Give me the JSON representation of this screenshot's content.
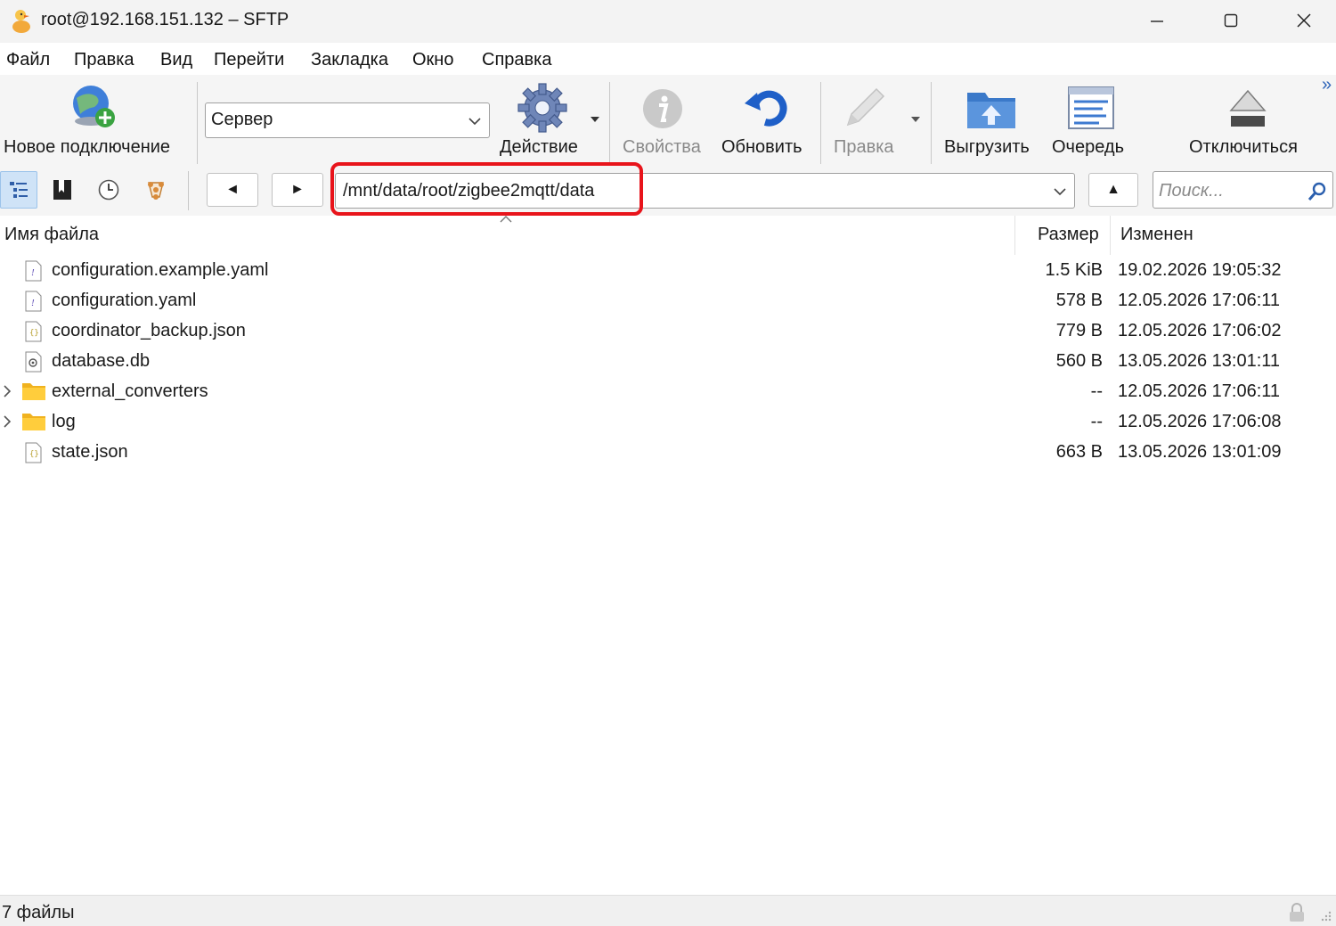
{
  "window": {
    "title": "root@192.168.151.132 – SFTP",
    "controls": [
      "minimize",
      "maximize",
      "close"
    ]
  },
  "menu": {
    "items": [
      "Файл",
      "Правка",
      "Вид",
      "Перейти",
      "Закладка",
      "Окно",
      "Справка"
    ]
  },
  "toolbar": {
    "new_connection": "Новое подключение",
    "server_combo": "Сервер",
    "action": "Действие",
    "properties": "Свойства",
    "refresh": "Обновить",
    "edit": "Правка",
    "upload": "Выгрузить",
    "queue": "Очередь",
    "disconnect": "Отключиться",
    "overflow": "»"
  },
  "pathbar": {
    "back_glyph": "◄",
    "forward_glyph": "►",
    "up_glyph": "▲",
    "path": "/mnt/data/root/zigbee2mqtt/data",
    "search_placeholder": "Поиск..."
  },
  "columns": {
    "name": "Имя файла",
    "size": "Размер",
    "modified": "Изменен"
  },
  "files": [
    {
      "name": "configuration.example.yaml",
      "size": "1.5 KiB",
      "modified": "19.02.2026 19:05:32",
      "type": "yaml-file-icon"
    },
    {
      "name": "configuration.yaml",
      "size": "578 B",
      "modified": "12.05.2026 17:06:11",
      "type": "yaml-file-icon"
    },
    {
      "name": "coordinator_backup.json",
      "size": "779 B",
      "modified": "12.05.2026 17:06:02",
      "type": "json-file-icon"
    },
    {
      "name": "database.db",
      "size": "560 B",
      "modified": "13.05.2026 13:01:11",
      "type": "db-file-icon"
    },
    {
      "name": "external_converters",
      "size": "--",
      "modified": "12.05.2026 17:06:11",
      "type": "folder-icon"
    },
    {
      "name": "log",
      "size": "--",
      "modified": "12.05.2026 17:06:08",
      "type": "folder-icon"
    },
    {
      "name": "state.json",
      "size": "663 B",
      "modified": "13.05.2026 13:01:09",
      "type": "json-file-icon"
    }
  ],
  "status": {
    "text": "7 файлы"
  }
}
